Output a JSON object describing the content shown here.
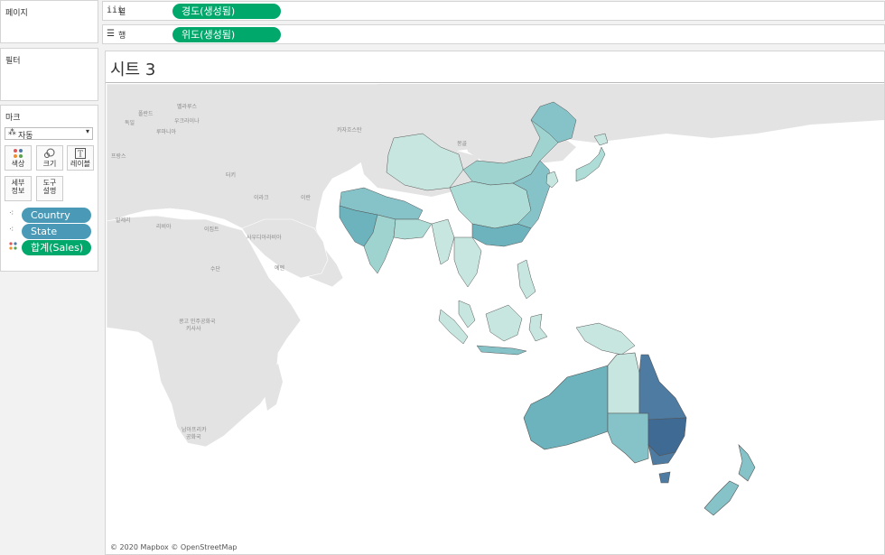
{
  "left_panel": {
    "pages_title": "페이지",
    "filters_title": "필터",
    "marks_title": "마크",
    "mark_type": "자동",
    "buttons": [
      {
        "icon": "color-dots-icon",
        "label": "색상"
      },
      {
        "icon": "size-icon",
        "label": "크기"
      },
      {
        "icon": "label-T-icon",
        "label": "레이블"
      },
      {
        "label_line1": "세부",
        "label_line2": "정보"
      },
      {
        "label_line1": "도구",
        "label_line2": "설명"
      }
    ],
    "mark_fields": [
      "Country",
      "State",
      "합계(Sales)"
    ]
  },
  "shelves": {
    "columns_label": "열",
    "columns_pill": "경도(생성됨)",
    "rows_label": "행",
    "rows_pill": "위도(생성됨)"
  },
  "sheet": {
    "title": "시트 3",
    "attribution": "© 2020 Mapbox © OpenStreetMap"
  },
  "map_labels": {
    "kazakhstan": "카자흐스탄",
    "mongolia": "몽골",
    "turkey": "터키",
    "algeria": "알제리",
    "libya": "리비아",
    "egypt": "이집트",
    "saudi": "사우디아라비아",
    "sudan": "수단",
    "yemen": "예멘",
    "iran": "이란",
    "iraq": "이라크",
    "drc_1": "콩고 민주공화국",
    "drc_2": "키사사",
    "south_africa_1": "남아프리카",
    "south_africa_2": "공화국",
    "france": "프랑스",
    "ukraine": "우크라이나",
    "poland": "폴란드",
    "belarus": "벨라루스",
    "germany": "독일",
    "romania": "루마니아"
  },
  "colors": {
    "accent_green": "#00a86b",
    "accent_blue": "#4a9ab7",
    "low_sales": "#c6e6df",
    "mid_sales": "#86c3c9",
    "high_sales": "#4d7ba1",
    "land_gray": "#e3e3e3"
  }
}
